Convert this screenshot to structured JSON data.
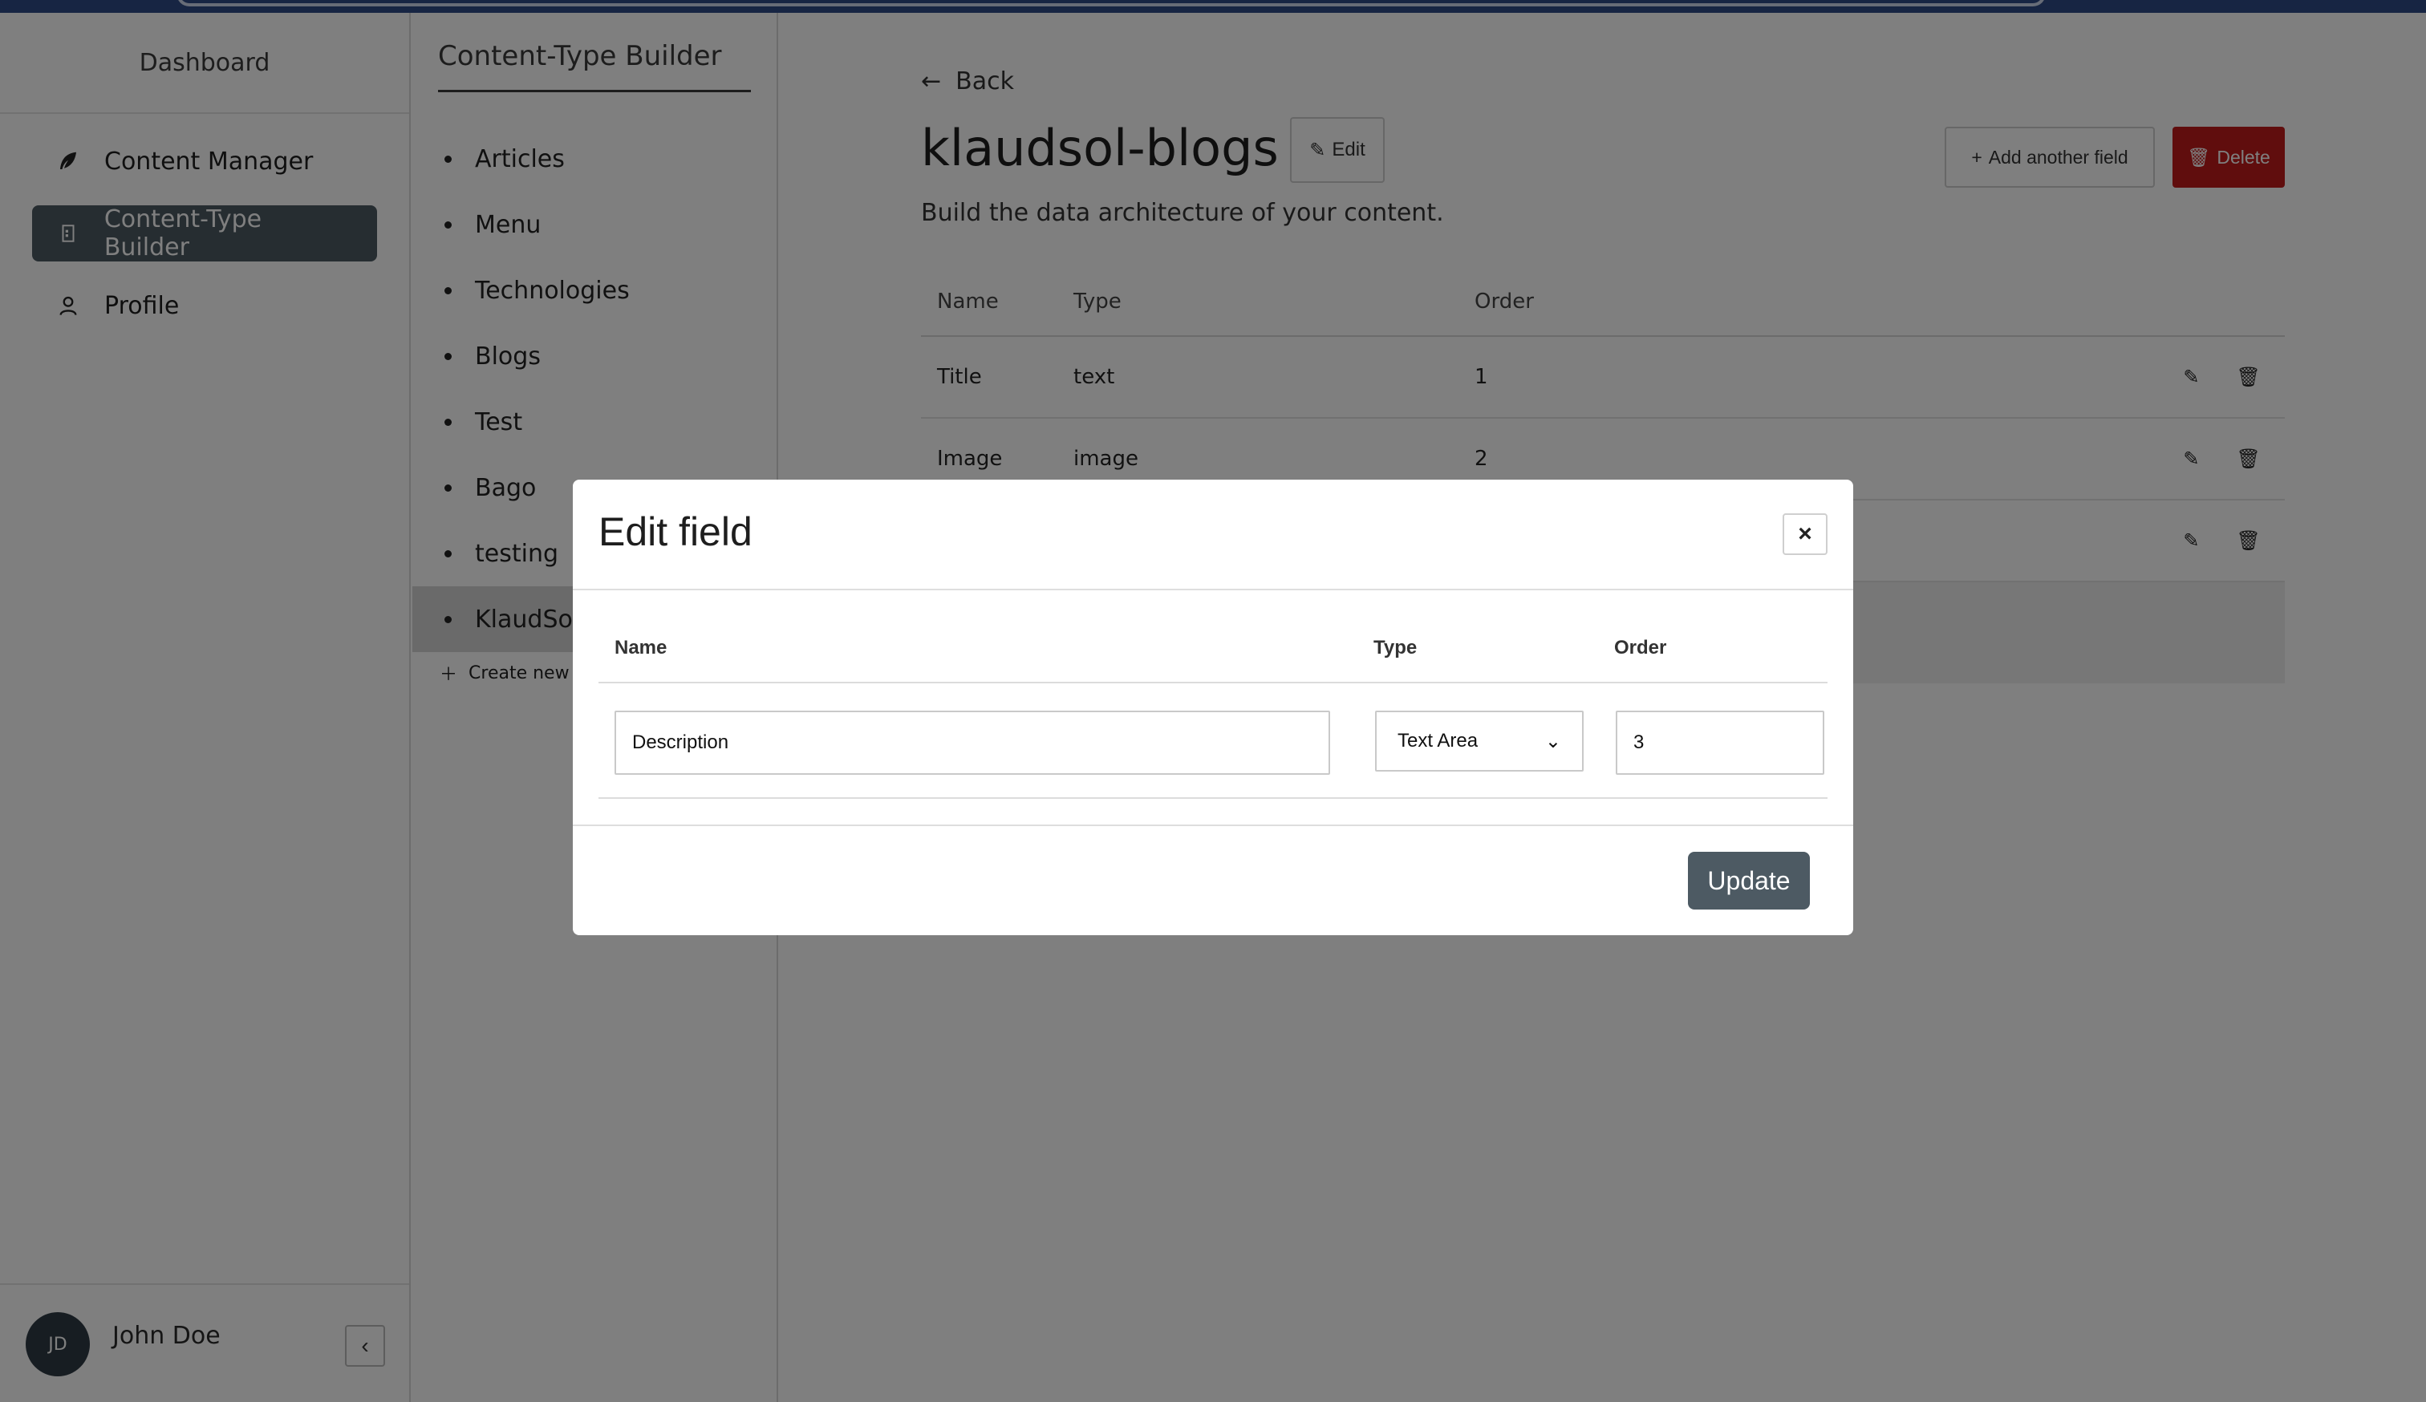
{
  "sidebar": {
    "title": "Dashboard",
    "items": [
      {
        "label": "Content Manager",
        "icon": "feather-icon",
        "active": false
      },
      {
        "label": "Content-Type Builder",
        "icon": "builder-icon",
        "active": true
      },
      {
        "label": "Profile",
        "icon": "user-icon",
        "active": false
      }
    ],
    "user": {
      "initials": "JD",
      "name": "John Doe"
    }
  },
  "ctb": {
    "title": "Content-Type Builder",
    "items": [
      "Articles",
      "Menu",
      "Technologies",
      "Blogs",
      "Test",
      "Bago",
      "testing",
      "KlaudSol"
    ],
    "create_label": "Create new c"
  },
  "main": {
    "back_label": "Back",
    "title": "klaudsol-blogs",
    "edit_label": "Edit",
    "add_field_label": "Add another field",
    "delete_label": "Delete",
    "subtitle": "Build the data architecture of your content.",
    "table": {
      "headers": [
        "Name",
        "Type",
        "Order"
      ],
      "rows": [
        {
          "name": "Title",
          "type": "text",
          "order": "1"
        },
        {
          "name": "Image",
          "type": "image",
          "order": "2"
        }
      ]
    }
  },
  "modal": {
    "title": "Edit field",
    "close_symbol": "×",
    "headers": {
      "name": "Name",
      "type": "Type",
      "order": "Order"
    },
    "name_value": "Description",
    "type_value": "Text Area",
    "order_value": "3",
    "update_label": "Update"
  },
  "colors": {
    "accent": "#4d5a63",
    "danger": "#c01a1a",
    "topbar": "#2f4a86"
  }
}
